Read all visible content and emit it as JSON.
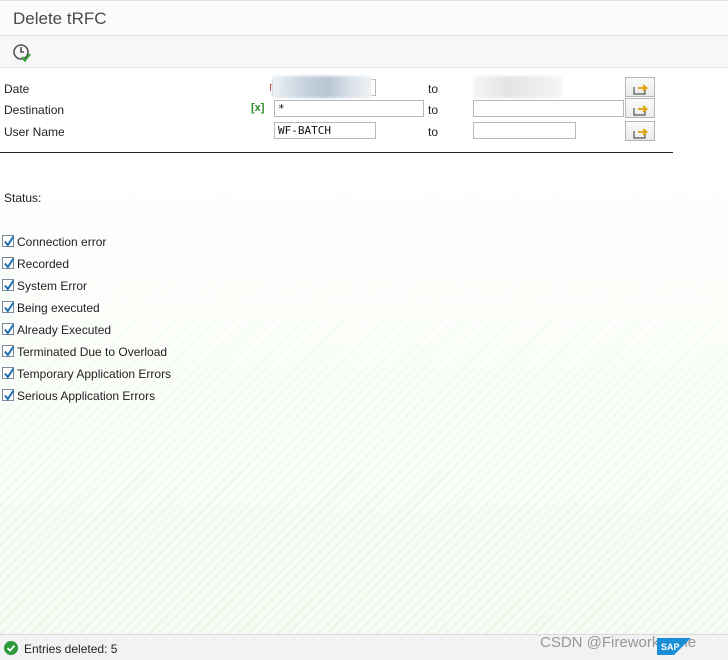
{
  "window": {
    "title": "Delete tRFC"
  },
  "toolbar": {
    "execute_icon": "execute-clock-icon"
  },
  "selection": {
    "rows": [
      {
        "label": "Date",
        "from_value": "",
        "to_label": "to",
        "to_value": ""
      },
      {
        "label": "Destination",
        "from_value": "*",
        "to_label": "to",
        "to_value": ""
      },
      {
        "label": "User Name",
        "from_value": "WF-BATCH",
        "to_label": "to",
        "to_value": ""
      }
    ],
    "destination_option_marker": "[x]"
  },
  "status": {
    "title": "Status:",
    "options": [
      {
        "label": "Connection error",
        "checked": true
      },
      {
        "label": "Recorded",
        "checked": true
      },
      {
        "label": "System Error",
        "checked": true
      },
      {
        "label": "Being executed",
        "checked": true
      },
      {
        "label": "Already Executed",
        "checked": true
      },
      {
        "label": "Terminated Due to Overload",
        "checked": true
      },
      {
        "label": "Temporary Application Errors",
        "checked": true
      },
      {
        "label": "Serious Application Errors",
        "checked": true
      }
    ]
  },
  "statusbar": {
    "message": "Entries deleted: 5",
    "type": "success"
  },
  "watermark": "CSDN @Fireworks_me"
}
